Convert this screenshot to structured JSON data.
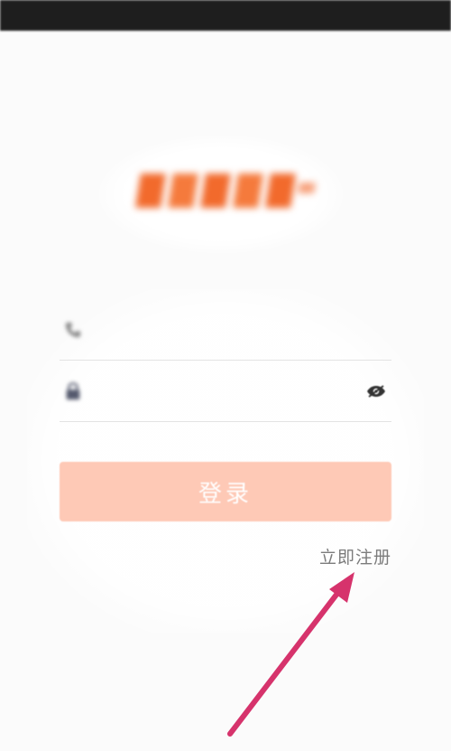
{
  "status_bar": {
    "left_text": "",
    "right_text": ""
  },
  "login_form": {
    "phone_placeholder": "",
    "password_placeholder": "",
    "password_toggle_icon": "eye-slash-icon",
    "phone_icon": "phone-icon",
    "lock_icon": "lock-icon",
    "submit_label": "登录",
    "forgot_label": "",
    "register_label": "立即注册"
  },
  "footer": {
    "prefix": "",
    "link": ""
  },
  "colors": {
    "brand_orange": "#f47a3e",
    "button_fill": "#fec9b6",
    "annotation_arrow": "#d6336c"
  }
}
